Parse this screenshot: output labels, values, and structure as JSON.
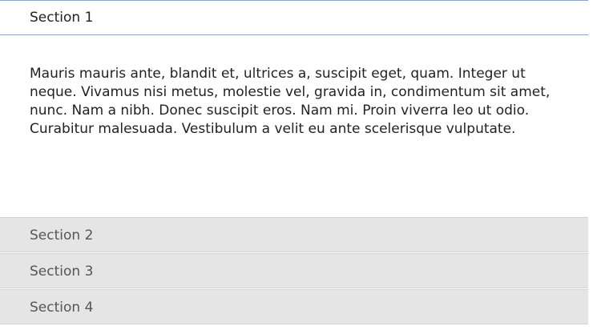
{
  "accordion": {
    "sections": [
      {
        "title": "Section 1",
        "expanded": true,
        "content": "Mauris mauris ante, blandit et, ultrices a, suscipit eget, quam. Integer ut neque. Vivamus nisi metus, molestie vel, gravida in, condimentum sit amet, nunc. Nam a nibh. Donec suscipit eros. Nam mi. Proin viverra leo ut odio. Curabitur malesuada. Vestibulum a velit eu ante scelerisque vulputate."
      },
      {
        "title": "Section 2",
        "expanded": false
      },
      {
        "title": "Section 3",
        "expanded": false
      },
      {
        "title": "Section 4",
        "expanded": false
      }
    ],
    "colors": {
      "active_border": "#7aa7e6",
      "collapsed_background": "#e5e5e5",
      "collapsed_border": "#d3d3d3",
      "active_text": "#222222",
      "collapsed_text": "#555555"
    }
  }
}
